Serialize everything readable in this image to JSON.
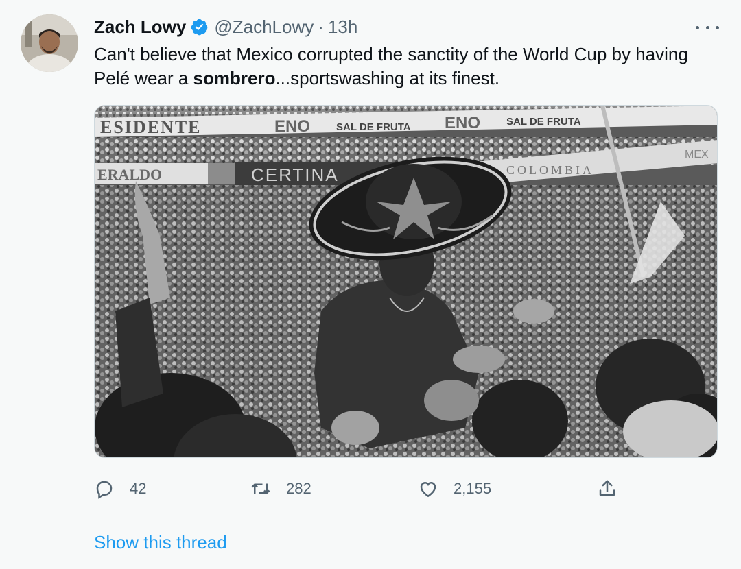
{
  "author": {
    "name": "Zach Lowy",
    "handle": "@ZachLowy",
    "separator": "·",
    "time": "13h",
    "verified": true,
    "avatar_icon": "user-avatar"
  },
  "tweet": {
    "text_before": "Can't believe that Mexico corrupted the sanctity of the World Cup by having Pelé wear a ",
    "text_bold": "sombrero",
    "text_after": "...sportswashing at its finest."
  },
  "media": {
    "banner_top_1": "ESIDENTE",
    "banner_top_2": "ENO",
    "banner_top_3": "SAL DE FRUTA",
    "banner_top_4": "ENO",
    "banner_top_5": "SAL DE FRUTA",
    "banner_mid_1": "ERALDO",
    "banner_mid_2": "CERTINA",
    "banner_mid_3": "COLOMBIA",
    "banner_mid_4": "MEX"
  },
  "actions": {
    "reply_count": "42",
    "retweet_count": "282",
    "like_count": "2,155",
    "icons": [
      "reply-icon",
      "retweet-icon",
      "like-icon",
      "share-icon"
    ]
  },
  "show_thread": "Show this thread",
  "colors": {
    "accent": "#1d9bf0",
    "secondary_text": "#536471",
    "primary_text": "#0f1419",
    "background": "#f7f9f9"
  }
}
